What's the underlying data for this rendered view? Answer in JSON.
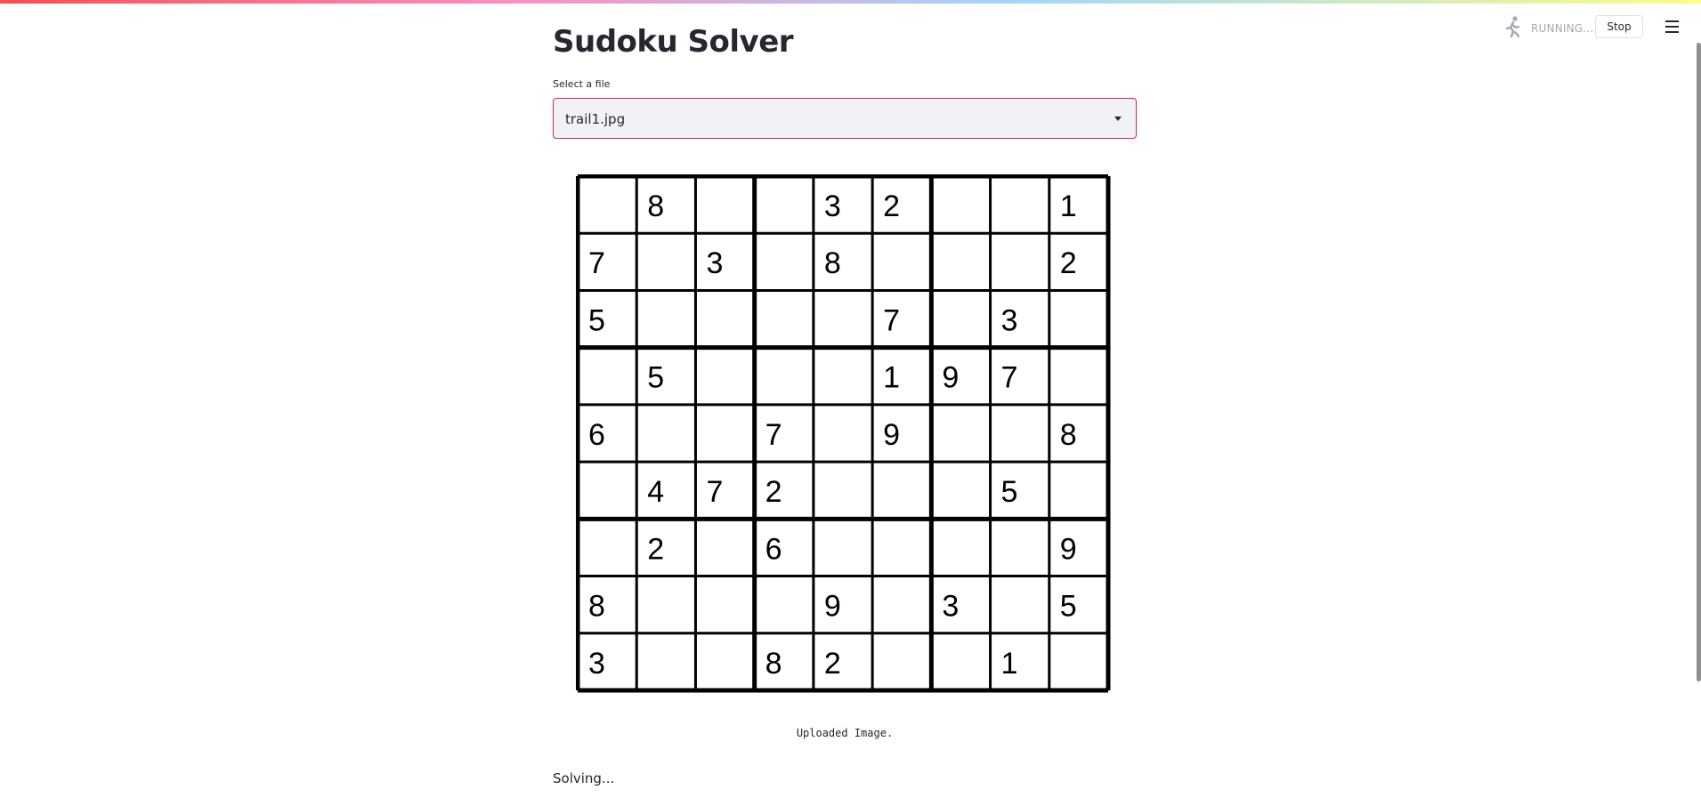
{
  "app": {
    "title": "Sudoku Solver",
    "status": "RUNNING...",
    "stop_label": "Stop",
    "status_icon": "running-person-icon",
    "menu_icon": "hamburger-menu-icon"
  },
  "file_select": {
    "label": "Select a file",
    "value": "trail1.jpg"
  },
  "image": {
    "caption": "Uploaded Image.",
    "grid": [
      [
        "",
        "8",
        "",
        "",
        "3",
        "2",
        "",
        "",
        "1"
      ],
      [
        "7",
        "",
        "3",
        "",
        "8",
        "",
        "",
        "",
        "2"
      ],
      [
        "5",
        "",
        "",
        "",
        "",
        "7",
        "",
        "3",
        ""
      ],
      [
        "",
        "5",
        "",
        "",
        "",
        "1",
        "9",
        "7",
        ""
      ],
      [
        "6",
        "",
        "",
        "7",
        "",
        "9",
        "",
        "",
        "8"
      ],
      [
        "",
        "4",
        "7",
        "2",
        "",
        "",
        "",
        "5",
        ""
      ],
      [
        "",
        "2",
        "",
        "6",
        "",
        "",
        "",
        "",
        "9"
      ],
      [
        "8",
        "",
        "",
        "",
        "9",
        "",
        "3",
        "",
        "5"
      ],
      [
        "3",
        "",
        "",
        "8",
        "2",
        "",
        "",
        "1",
        ""
      ]
    ]
  },
  "status_message": "Solving...",
  "colors": {
    "accent": "#d6274a",
    "text": "#262730",
    "select_bg": "#f0f2f6"
  }
}
